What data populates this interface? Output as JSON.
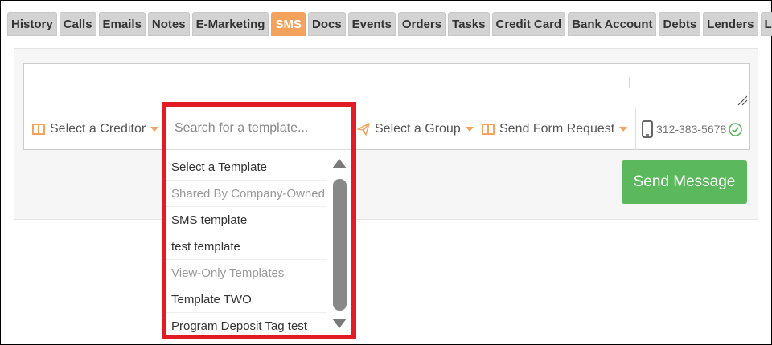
{
  "tabs": [
    {
      "label": "History"
    },
    {
      "label": "Calls"
    },
    {
      "label": "Emails"
    },
    {
      "label": "Notes"
    },
    {
      "label": "E-Marketing"
    },
    {
      "label": "SMS",
      "active": true
    },
    {
      "label": "Docs"
    },
    {
      "label": "Events"
    },
    {
      "label": "Orders"
    },
    {
      "label": "Tasks"
    },
    {
      "label": "Credit Card"
    },
    {
      "label": "Bank Account"
    },
    {
      "label": "Debts"
    },
    {
      "label": "Lenders"
    },
    {
      "label": "Loans"
    }
  ],
  "composer": {
    "message_value": "",
    "creditor_label": "Select a Creditor",
    "group_label": "Select a Group",
    "form_request_label": "Send Form Request",
    "phone": "312-383-5678",
    "send_label": "Send Message"
  },
  "template_dropdown": {
    "search_placeholder": "Search for a template...",
    "options": [
      {
        "label": "Select a Template",
        "group": false
      },
      {
        "label": "Shared By Company-Owned",
        "group": true
      },
      {
        "label": "SMS template",
        "group": false
      },
      {
        "label": "test template",
        "group": false
      },
      {
        "label": "View-Only Templates",
        "group": true
      },
      {
        "label": "Template TWO",
        "group": false
      },
      {
        "label": "Program Deposit Tag test",
        "group": false
      }
    ]
  },
  "colors": {
    "active_tab": "#f5a35c",
    "send_button": "#5cb85c",
    "highlight_border": "#e31b25",
    "phone_verified": "#5cb85c"
  },
  "icons": {
    "creditor": "columns-icon",
    "group": "paper-plane-icon",
    "form_request": "columns-icon",
    "phone": "mobile-phone-icon",
    "verified": "check-circle-icon"
  }
}
